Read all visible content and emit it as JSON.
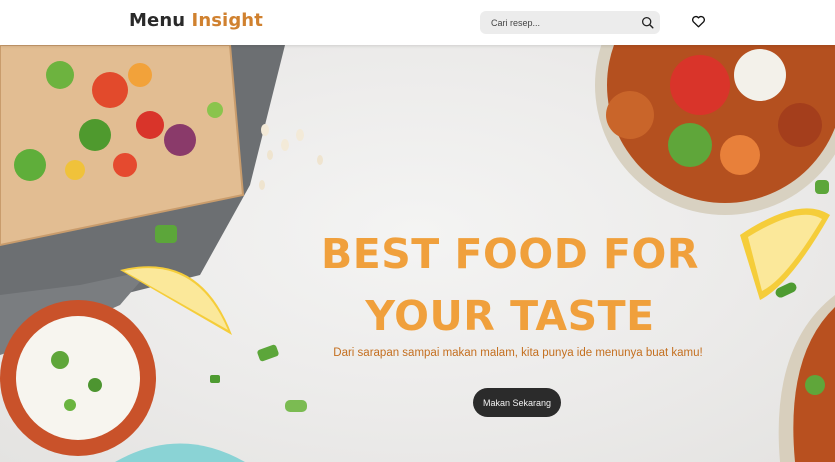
{
  "navbar": {
    "logo_part1": "Menu",
    "logo_part2": "Insight",
    "search_placeholder": "Cari resep...",
    "search_icon": "search-icon",
    "favorites_icon": "heart-icon"
  },
  "hero": {
    "headline_line1": "BEST FOOD FOR",
    "headline_line2": "YOUR TASTE",
    "subtitle": "Dari sarapan sampai makan malam, kita punya ide menunya buat kamu!",
    "cta_label": "Makan Sekarang"
  },
  "colors": {
    "accent": "#f0a03c",
    "subtitle": "#c46f1f",
    "logo_accent": "#d0812f",
    "button_bg": "#2b2b2b"
  }
}
